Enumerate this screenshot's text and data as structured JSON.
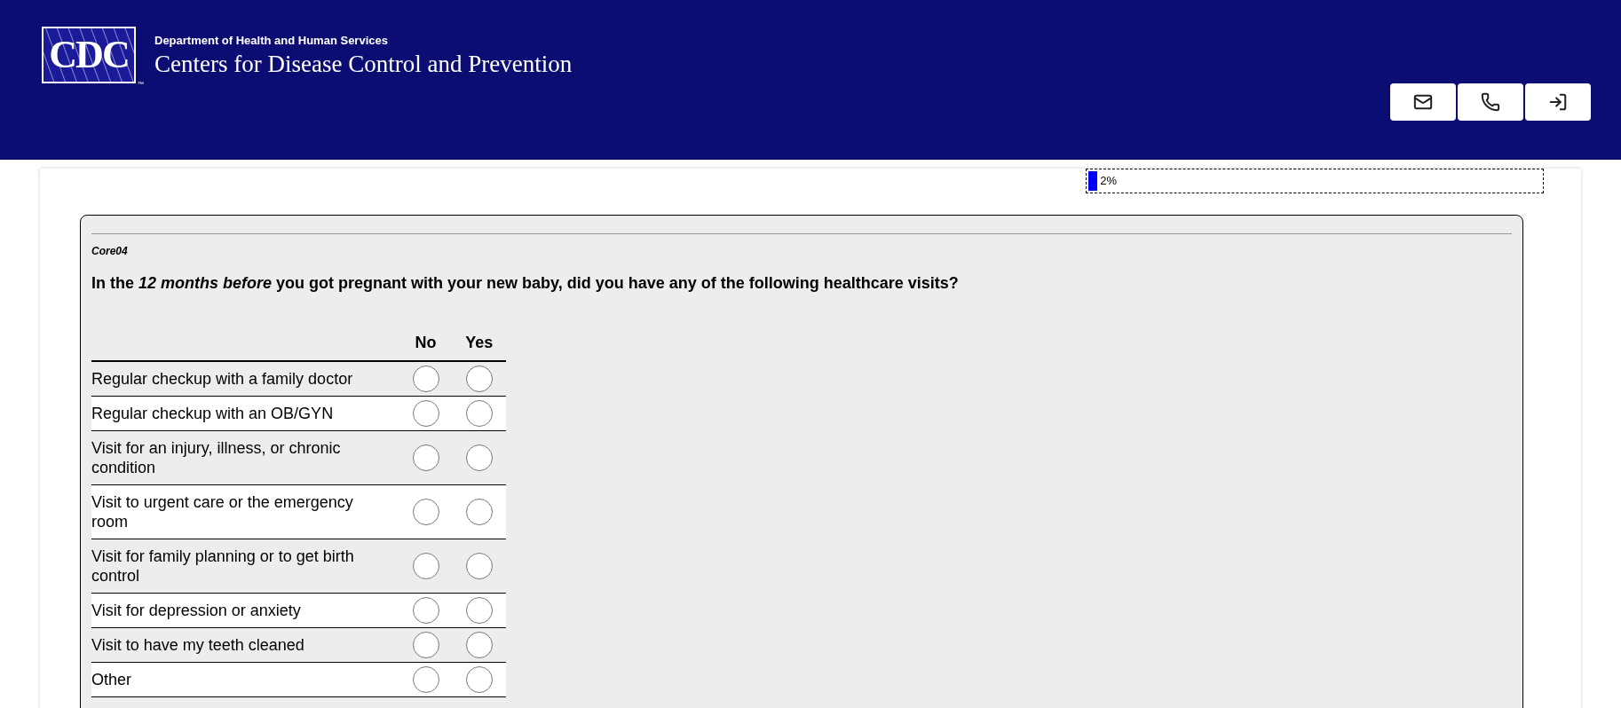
{
  "header": {
    "logo_text": "CDC",
    "trademark": "™",
    "department": "Department of Health and Human Services",
    "agency": "Centers for Disease Control and Prevention"
  },
  "header_buttons": [
    {
      "kind": "email"
    },
    {
      "kind": "phone"
    },
    {
      "kind": "exit"
    }
  ],
  "progress": {
    "level": 0.02,
    "reading": "2%"
  },
  "question": {
    "code": "Core04",
    "text": "In the *12 months before* you got pregnant with your new baby, did you have any of the following healthcare visits?",
    "columns": [
      "No",
      "Yes"
    ],
    "rows": [
      {
        "label": "Regular checkup with a family doctor",
        "no": false,
        "yes": false
      },
      {
        "label": "Regular checkup with an OB/GYN",
        "no": false,
        "yes": false
      },
      {
        "label": "Visit for an injury, illness, or chronic condition",
        "no": false,
        "yes": false
      },
      {
        "label": "Visit to urgent care or the emergency room",
        "no": false,
        "yes": false
      },
      {
        "label": "Visit for family planning or to get birth control",
        "no": false,
        "yes": false
      },
      {
        "label": "Visit for depression or anxiety",
        "no": false,
        "yes": false
      },
      {
        "label": "Visit to have my teeth cleaned",
        "no": false,
        "yes": false
      },
      {
        "label": "Other",
        "no": false,
        "yes": false
      }
    ]
  }
}
